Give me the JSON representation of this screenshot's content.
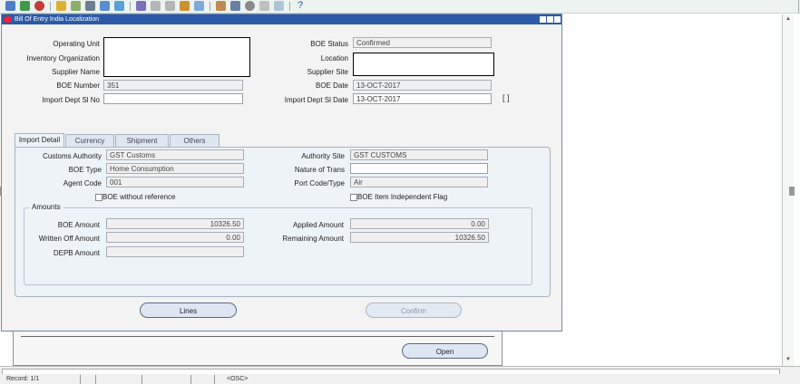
{
  "window": {
    "title": "Bill Of Entry India Localization"
  },
  "header": {
    "operating_unit_label": "Operating Unit",
    "inventory_org_label": "Inventory Organization",
    "supplier_name_label": "Supplier Name",
    "boe_number_label": "BOE Number",
    "boe_number": "351",
    "import_dept_sl_no_label": "Import Dept Sl No",
    "boe_status_label": "BOE Status",
    "boe_status": "Confirmed",
    "location_label": "Location",
    "supplier_site_label": "Supplier Site",
    "boe_date_label": "BOE Date",
    "boe_date": "13-OCT-2017",
    "import_dept_sl_date_label": "Import Dept Sl Date",
    "import_dept_sl_date": "13-OCT-2017",
    "flex_bracket": "[ ]"
  },
  "tabs": [
    "Import Detail",
    "Currency",
    "Shipment",
    "Others"
  ],
  "import_detail": {
    "customs_authority_label": "Customs Authority",
    "customs_authority": "GST Customs",
    "boe_type_label": "BOE Type",
    "boe_type": "Home Consumption",
    "agent_code_label": "Agent Code",
    "agent_code": "001",
    "boe_without_ref_label": "BOE without reference",
    "authority_site_label": "Authority Site",
    "authority_site": "GST CUSTOMS",
    "nature_of_trans_label": "Nature of Trans",
    "port_code_type_label": "Port Code/Type",
    "port_code_type": "Air",
    "boe_item_indep_label": "BOE Item Independent Flag"
  },
  "amounts": {
    "group_label": "Amounts",
    "boe_amount_label": "BOE Amount",
    "boe_amount": "10326.50",
    "written_off_label": "Written Off Amount",
    "written_off": "0.00",
    "depb_label": "DEPB Amount",
    "applied_label": "Applied Amount",
    "applied": "0.00",
    "remaining_label": "Remaining Amount",
    "remaining": "10326.50"
  },
  "buttons": {
    "lines": "Lines",
    "confirm": "Confirm",
    "open": "Open"
  },
  "status_bar": {
    "record": "Record: 1/1",
    "osc": "<OSC>"
  },
  "toolbar": {
    "help": "?"
  }
}
